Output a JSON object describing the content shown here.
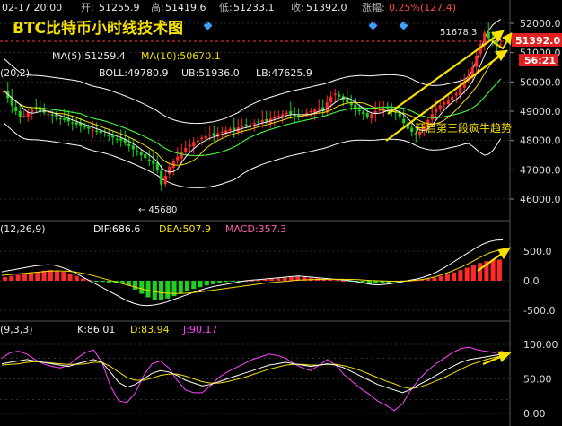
{
  "header": {
    "datetime": "02-17 20:00",
    "open_label": "开:",
    "open": "51255.9",
    "high_label": "高:",
    "high": "51419.6",
    "low_label": "低:",
    "low": "51233.1",
    "close_label": "收:",
    "close": "51392.0",
    "change_label": "涨幅:",
    "change": "0.25%(127.4)"
  },
  "title": "BTC比特币小时线技术图",
  "price_panel": {
    "ma_row": {
      "ma5": "MA(5):51259.4",
      "ma10": "MA(10):50670.1"
    },
    "boll_row": {
      "params": "(20,2)",
      "boll": "BOLL:49780.9",
      "ub": "UB:51936.0",
      "lb": "LB:47625.9"
    },
    "peak_label": "51678.3",
    "low_marker": "← 45680",
    "annotation": "开启第三段疯牛趋势",
    "price_tag": "51392.0",
    "countdown": "56:21",
    "axis_ticks": [
      "52000.0",
      "51000.0",
      "50000.0",
      "49000.0",
      "48000.0",
      "47000.0",
      "46000.0"
    ]
  },
  "macd_panel": {
    "params": "(12,26,9)",
    "dif": "DIF:686.6",
    "dea": "DEA:507.9",
    "macd": "MACD:357.3",
    "axis_ticks": [
      "500.0",
      "0.0",
      "-500.0"
    ]
  },
  "kdj_panel": {
    "params": "(9,3,3)",
    "k": "K:86.01",
    "d": "D:83.94",
    "j": "J:90.17",
    "axis_ticks": [
      "100.00",
      "50.00",
      "0.00"
    ]
  },
  "colors": {
    "up": "#ff2a2a",
    "down": "#1fd11f",
    "ma5": "#f0f0f0",
    "ma10": "#f5e000",
    "ma20": "#38ff38",
    "boll": "#ffffff",
    "macd_dif": "#ffffff",
    "macd_dea": "#f5e000",
    "k": "#ffffff",
    "d": "#f5e000",
    "j": "#ff44ff",
    "arrow": "#f5e000",
    "title": "#f5e000"
  },
  "chart_data": [
    {
      "type": "candlestick",
      "title": "BTC比特币小时线技术图",
      "interval": "1h",
      "ylim": [
        45500,
        52600
      ],
      "mid": [
        49700,
        49450,
        49200,
        49000,
        48800,
        48850,
        48950,
        49050,
        49100,
        49000,
        48950,
        48900,
        48850,
        48800,
        48750,
        48700,
        48650,
        48600,
        48550,
        48500,
        48450,
        48400,
        48350,
        48300,
        48250,
        48200,
        48150,
        48100,
        48050,
        48000,
        47900,
        47800,
        47700,
        47600,
        47500,
        47400,
        47300,
        47200,
        47000,
        46500,
        46800,
        47100,
        47300,
        47450,
        47600,
        47750,
        47850,
        47950,
        48000,
        48100,
        48150,
        48200,
        48150,
        48250,
        48300,
        48350,
        48400,
        48350,
        48450,
        48500,
        48500,
        48550,
        48600,
        48650,
        48700,
        48650,
        48750,
        48800,
        48850,
        48900,
        48950,
        48900,
        48850,
        48800,
        48900,
        48950,
        49000,
        49050,
        49100,
        49000,
        49300,
        49500,
        49600,
        49500,
        49400,
        49300,
        49200,
        49100,
        49000,
        48900,
        48800,
        48900,
        49000,
        49050,
        49100,
        49050,
        49000,
        48950,
        48800,
        48600,
        48400,
        48300,
        48200,
        48300,
        48500,
        48700,
        48900,
        49100,
        49200,
        49300,
        49400,
        49500,
        49600,
        49800,
        50000,
        50200,
        50500,
        50900,
        51300,
        51678,
        51500,
        51392,
        51250,
        51300
      ]
    },
    {
      "type": "bar+line",
      "title": "MACD",
      "ylim": [
        -650,
        900
      ],
      "macd": [
        60,
        80,
        100,
        120,
        140,
        150,
        170,
        180,
        170,
        150,
        120,
        80,
        40,
        10,
        -10,
        -20,
        -30,
        -30,
        -40,
        -80,
        -150,
        -220,
        -280,
        -320,
        -330,
        -300,
        -260,
        -220,
        -180,
        -140,
        -110,
        -80,
        -60,
        -40,
        -20,
        -10,
        -5,
        0,
        5,
        10,
        20,
        30,
        40,
        50,
        60,
        70,
        60,
        50,
        40,
        30,
        20,
        10,
        0,
        -10,
        -20,
        -40,
        -60,
        -50,
        -40,
        -30,
        -20,
        -10,
        0,
        10,
        20,
        30,
        50,
        80,
        110,
        140,
        180,
        220,
        260,
        300,
        330,
        350,
        357
      ],
      "dif": [
        150,
        170,
        190,
        210,
        230,
        250,
        260,
        270,
        260,
        230,
        190,
        140,
        80,
        20,
        -40,
        -100,
        -160,
        -220,
        -280,
        -340,
        -380,
        -410,
        -420,
        -410,
        -390,
        -360,
        -320,
        -280,
        -240,
        -200,
        -160,
        -130,
        -100,
        -80,
        -60,
        -40,
        -20,
        0,
        10,
        20,
        30,
        40,
        50,
        60,
        70,
        80,
        70,
        60,
        50,
        40,
        30,
        20,
        10,
        0,
        -20,
        -40,
        -60,
        -70,
        -60,
        -50,
        -30,
        -10,
        10,
        30,
        60,
        100,
        150,
        210,
        280,
        350,
        420,
        490,
        560,
        620,
        660,
        686.6,
        690
      ],
      "dea": [
        90,
        100,
        110,
        120,
        130,
        140,
        150,
        160,
        165,
        165,
        160,
        150,
        130,
        110,
        80,
        50,
        20,
        -10,
        -40,
        -70,
        -100,
        -130,
        -160,
        -180,
        -200,
        -210,
        -215,
        -215,
        -210,
        -200,
        -190,
        -175,
        -160,
        -145,
        -130,
        -115,
        -100,
        -85,
        -70,
        -55,
        -40,
        -30,
        -20,
        -10,
        0,
        10,
        15,
        20,
        22,
        24,
        25,
        25,
        24,
        22,
        18,
        12,
        5,
        0,
        -5,
        -8,
        -8,
        -5,
        0,
        10,
        25,
        45,
        75,
        110,
        150,
        195,
        245,
        300,
        360,
        420,
        470,
        507.9,
        520
      ]
    },
    {
      "type": "line",
      "title": "KDJ",
      "ylim": [
        -5,
        112
      ],
      "k": [
        72,
        74,
        76,
        78,
        76,
        74,
        72,
        70,
        68,
        72,
        75,
        78,
        74,
        60,
        45,
        38,
        42,
        50,
        58,
        62,
        60,
        55,
        48,
        44,
        40,
        42,
        46,
        50,
        54,
        58,
        62,
        66,
        70,
        72,
        74,
        72,
        70,
        68,
        70,
        72,
        70,
        66,
        60,
        54,
        48,
        42,
        38,
        34,
        30,
        35,
        42,
        48,
        55,
        62,
        68,
        74,
        78,
        80,
        82,
        84,
        86.01
      ],
      "d": [
        70,
        71,
        72,
        74,
        75,
        74,
        73,
        72,
        71,
        71,
        72,
        74,
        74,
        68,
        60,
        52,
        48,
        48,
        51,
        55,
        57,
        57,
        54,
        50,
        46,
        44,
        44,
        46,
        49,
        52,
        56,
        60,
        64,
        67,
        70,
        71,
        71,
        70,
        70,
        71,
        71,
        69,
        66,
        62,
        57,
        52,
        47,
        43,
        38,
        36,
        38,
        42,
        47,
        52,
        58,
        64,
        70,
        74,
        78,
        81,
        83.94
      ],
      "j": [
        80,
        88,
        90,
        86,
        78,
        72,
        68,
        66,
        70,
        80,
        88,
        92,
        74,
        40,
        18,
        16,
        30,
        55,
        72,
        76,
        66,
        48,
        34,
        30,
        30,
        40,
        52,
        60,
        66,
        72,
        78,
        82,
        86,
        84,
        80,
        72,
        66,
        62,
        70,
        78,
        70,
        56,
        46,
        36,
        28,
        18,
        12,
        4,
        14,
        34,
        50,
        62,
        72,
        80,
        88,
        94,
        96,
        92,
        90,
        88,
        90.17
      ]
    }
  ]
}
